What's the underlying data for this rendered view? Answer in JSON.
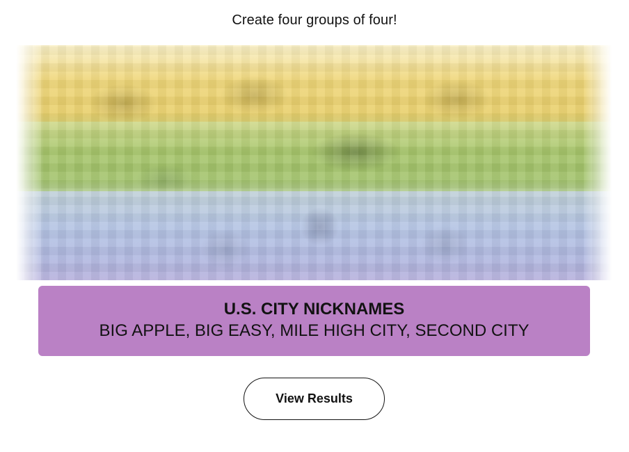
{
  "game": {
    "instructions": "Create four groups of four!",
    "solved_groups": [
      {
        "category": "U.S. CITY NICKNAMES",
        "members": "BIG APPLE, BIG EASY, MILE HIGH CITY, SECOND CITY",
        "color": "#ba81c5"
      }
    ],
    "blurred_board_colors": [
      "#f9df6d",
      "#a0c35a",
      "#b0c4ef"
    ],
    "view_results_label": "View Results"
  }
}
